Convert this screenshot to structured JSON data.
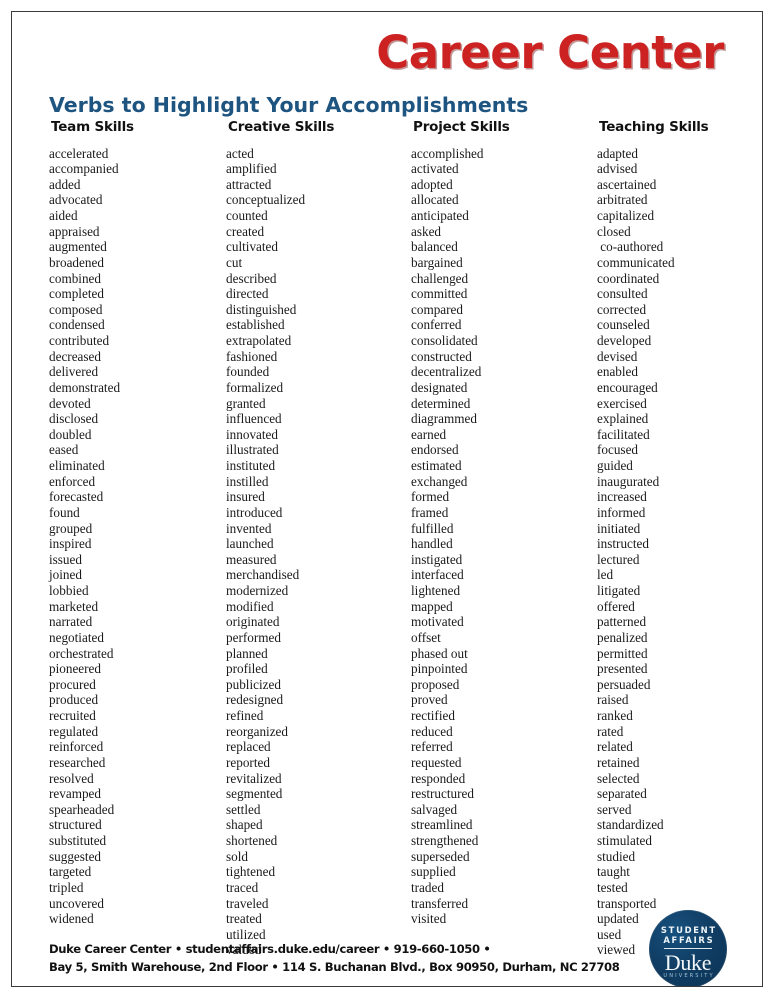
{
  "document": {
    "brand_title": "Career Center",
    "subtitle": "Verbs to Highlight Your Accomplishments",
    "accent_red": "#cc2222",
    "accent_blue": "#1d5480",
    "seal_navy": "#113f66"
  },
  "columns": [
    {
      "header": "Team Skills",
      "words": [
        "accelerated",
        "accompanied",
        "added",
        "advocated",
        "aided",
        "appraised",
        "augmented",
        "broadened",
        "combined",
        "completed",
        "composed",
        "condensed",
        "contributed",
        "decreased",
        "delivered",
        "demonstrated",
        "devoted",
        "disclosed",
        "doubled",
        "eased",
        "eliminated",
        "enforced",
        "forecasted",
        "found",
        "grouped",
        "inspired",
        "issued",
        "joined",
        "lobbied",
        "marketed",
        "narrated",
        "negotiated",
        "orchestrated",
        "pioneered",
        "procured",
        "produced",
        "recruited",
        "regulated",
        "reinforced",
        "researched",
        "resolved",
        "revamped",
        "spearheaded",
        "structured",
        "substituted",
        "suggested",
        "targeted",
        "tripled",
        "uncovered",
        "widened"
      ]
    },
    {
      "header": "Creative Skills",
      "words": [
        "acted",
        "amplified",
        "attracted",
        "conceptualized",
        "counted",
        "created",
        "cultivated",
        "cut",
        "described",
        "directed",
        "distinguished",
        "established",
        "extrapolated",
        "fashioned",
        "founded",
        "formalized",
        "granted",
        "influenced",
        "innovated",
        "illustrated",
        "instituted",
        "instilled",
        "insured",
        "introduced",
        "invented",
        "launched",
        "measured",
        "merchandised",
        "modernized",
        "modified",
        "originated",
        "performed",
        "planned",
        "profiled",
        "publicized",
        "redesigned",
        "refined",
        "reorganized",
        "replaced",
        "reported",
        "revitalized",
        "segmented",
        "settled",
        "shaped",
        "shortened",
        "sold",
        "tightened",
        "traced",
        "traveled",
        "treated",
        "utilized",
        "valued"
      ]
    },
    {
      "header": "Project Skills",
      "words": [
        "accomplished",
        "activated",
        "adopted",
        "allocated",
        "anticipated",
        "asked",
        "balanced",
        "bargained",
        "challenged",
        "committed",
        "compared",
        "conferred",
        "consolidated",
        "constructed",
        "decentralized",
        "designated",
        "determined",
        "diagrammed",
        "earned",
        "endorsed",
        "estimated",
        "exchanged",
        "formed",
        "framed",
        "fulfilled",
        "handled",
        "instigated",
        "interfaced",
        "lightened",
        "mapped",
        "motivated",
        "offset",
        "phased out",
        "pinpointed",
        "proposed",
        "proved",
        "rectified",
        "reduced",
        "referred",
        "requested",
        "responded",
        "restructured",
        "salvaged",
        "streamlined",
        "strengthened",
        "superseded",
        "supplied",
        "traded",
        "transferred",
        "visited"
      ]
    },
    {
      "header": "Teaching Skills",
      "words": [
        "adapted",
        "advised",
        "ascertained",
        "arbitrated",
        "capitalized",
        "closed",
        " co-authored",
        "communicated",
        "coordinated",
        "consulted",
        "corrected",
        "counseled",
        "developed",
        "devised",
        "enabled",
        "encouraged",
        "exercised",
        "explained",
        "facilitated",
        "focused",
        "guided",
        "inaugurated",
        "increased",
        "informed",
        "initiated",
        "instructed",
        "lectured",
        "led",
        "litigated",
        "offered",
        "patterned",
        "penalized",
        "permitted",
        "presented",
        "persuaded",
        "raised",
        "ranked",
        "rated",
        "related",
        "retained",
        "selected",
        "separated",
        "served",
        "standardized",
        "stimulated",
        "studied",
        "taught",
        "tested",
        "transported",
        "updated",
        "used",
        "viewed"
      ]
    }
  ],
  "seal": {
    "line1": "STUDENT",
    "line2": "AFFAIRS",
    "wordmark": "Duke",
    "university": "UNIVERSITY"
  },
  "footer": {
    "line1": "Duke Career Center • studentaffairs.duke.edu/career • 919-660-1050 •",
    "line2": "Bay 5, Smith Warehouse, 2nd Floor • 114 S. Buchanan Blvd., Box 90950, Durham, NC 27708"
  }
}
